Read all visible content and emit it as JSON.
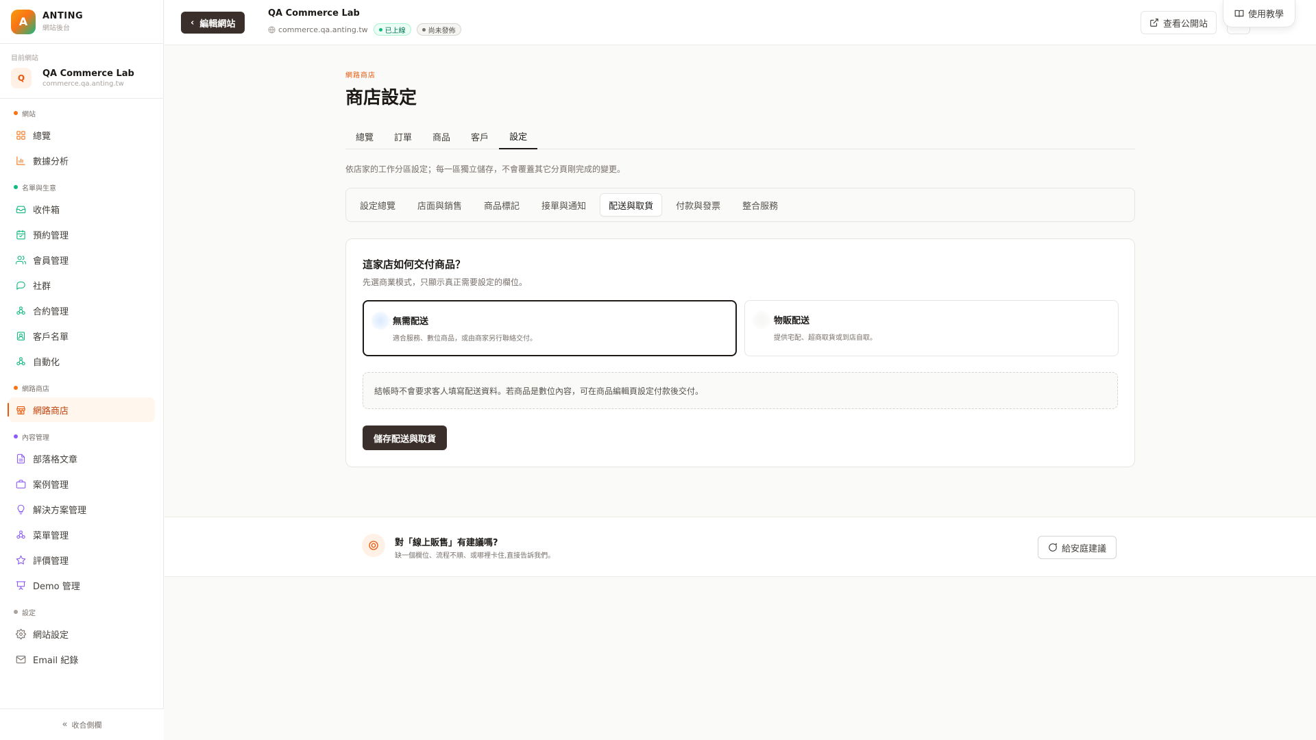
{
  "brand": {
    "letter": "A",
    "name": "ANTING",
    "sub": "網站後台"
  },
  "current_site": {
    "label": "目前網站",
    "avatar": "Q",
    "name": "QA Commerce Lab",
    "domain": "commerce.qa.anting.tw"
  },
  "sidebar": {
    "sections": [
      {
        "label": "網站",
        "color": "#f97316"
      },
      {
        "label": "名單與生意",
        "color": "#10b981"
      },
      {
        "label": "網路商店",
        "color": "#f97316"
      },
      {
        "label": "內容管理",
        "color": "#8b5cf6"
      },
      {
        "label": "設定",
        "color": "#a8a29e"
      }
    ],
    "items": [
      {
        "label": "總覽",
        "icon": "grid-icon",
        "color": "#f97316"
      },
      {
        "label": "數據分析",
        "icon": "bar-chart-icon",
        "color": "#f97316"
      },
      {
        "label": "收件箱",
        "icon": "inbox-icon",
        "color": "#10b981"
      },
      {
        "label": "預約管理",
        "icon": "calendar-icon",
        "color": "#10b981"
      },
      {
        "label": "會員管理",
        "icon": "users-icon",
        "color": "#10b981"
      },
      {
        "label": "社群",
        "icon": "chat-icon",
        "color": "#10b981"
      },
      {
        "label": "合約管理",
        "icon": "workflow-icon",
        "color": "#10b981"
      },
      {
        "label": "客戶名單",
        "icon": "contact-icon",
        "color": "#10b981"
      },
      {
        "label": "自動化",
        "icon": "workflow-icon",
        "color": "#10b981"
      },
      {
        "label": "網路商店",
        "icon": "store-icon",
        "color": "#ea580c"
      },
      {
        "label": "部落格文章",
        "icon": "document-icon",
        "color": "#8b5cf6"
      },
      {
        "label": "案例管理",
        "icon": "briefcase-icon",
        "color": "#8b5cf6"
      },
      {
        "label": "解決方案管理",
        "icon": "lightbulb-icon",
        "color": "#8b5cf6"
      },
      {
        "label": "菜單管理",
        "icon": "workflow-icon",
        "color": "#8b5cf6"
      },
      {
        "label": "評價管理",
        "icon": "star-icon",
        "color": "#8b5cf6"
      },
      {
        "label": "Demo 管理",
        "icon": "presentation-icon",
        "color": "#8b5cf6"
      },
      {
        "label": "網站設定",
        "icon": "gear-icon",
        "color": "#78716c"
      },
      {
        "label": "Email 紀錄",
        "icon": "mail-icon",
        "color": "#78716c"
      }
    ],
    "collapse_label": "收合側欄"
  },
  "header": {
    "edit_label": "編輯網站",
    "site_title": "QA Commerce Lab",
    "site_domain": "commerce.qa.anting.tw",
    "status_live": "已上線",
    "status_draft": "尚未發佈",
    "view_label": "查看公開站",
    "help_label": "使用教學"
  },
  "main": {
    "eyebrow": "網路商店",
    "title": "商店設定",
    "tabs": [
      "總覽",
      "訂單",
      "商品",
      "客戶",
      "設定"
    ],
    "active_tab": 4,
    "description": "依店家的工作分區設定；每一區獨立儲存，不會覆蓋其它分頁剛完成的變更。",
    "subtabs": [
      "設定總覽",
      "店面與銷售",
      "商品標記",
      "接單與通知",
      "配送與取貨",
      "付款與發票",
      "整合服務"
    ],
    "active_subtab": 4
  },
  "delivery": {
    "title": "這家店如何交付商品？",
    "subtitle": "先選商業模式，只顯示真正需要設定的欄位。",
    "options": [
      {
        "title": "無需配送",
        "desc": "適合服務、數位商品，或由商家另行聯絡交付。",
        "selected": true
      },
      {
        "title": "物販配送",
        "desc": "提供宅配、超商取貨或到店自取。",
        "selected": false
      }
    ],
    "note": "結帳時不會要求客人填寫配送資料。若商品是數位內容，可在商品編輯頁設定付款後交付。",
    "save_label": "儲存配送與取貨"
  },
  "feedback": {
    "title": "對「線上販售」有建議嗎?",
    "subtitle": "缺一個欄位、流程不順、或哪裡卡住,直接告訴我們。",
    "button_label": "給安庭建議"
  },
  "colors": {
    "primary_dark": "#3a2f2a",
    "accent": "#ea580c",
    "live": "#10b981"
  }
}
